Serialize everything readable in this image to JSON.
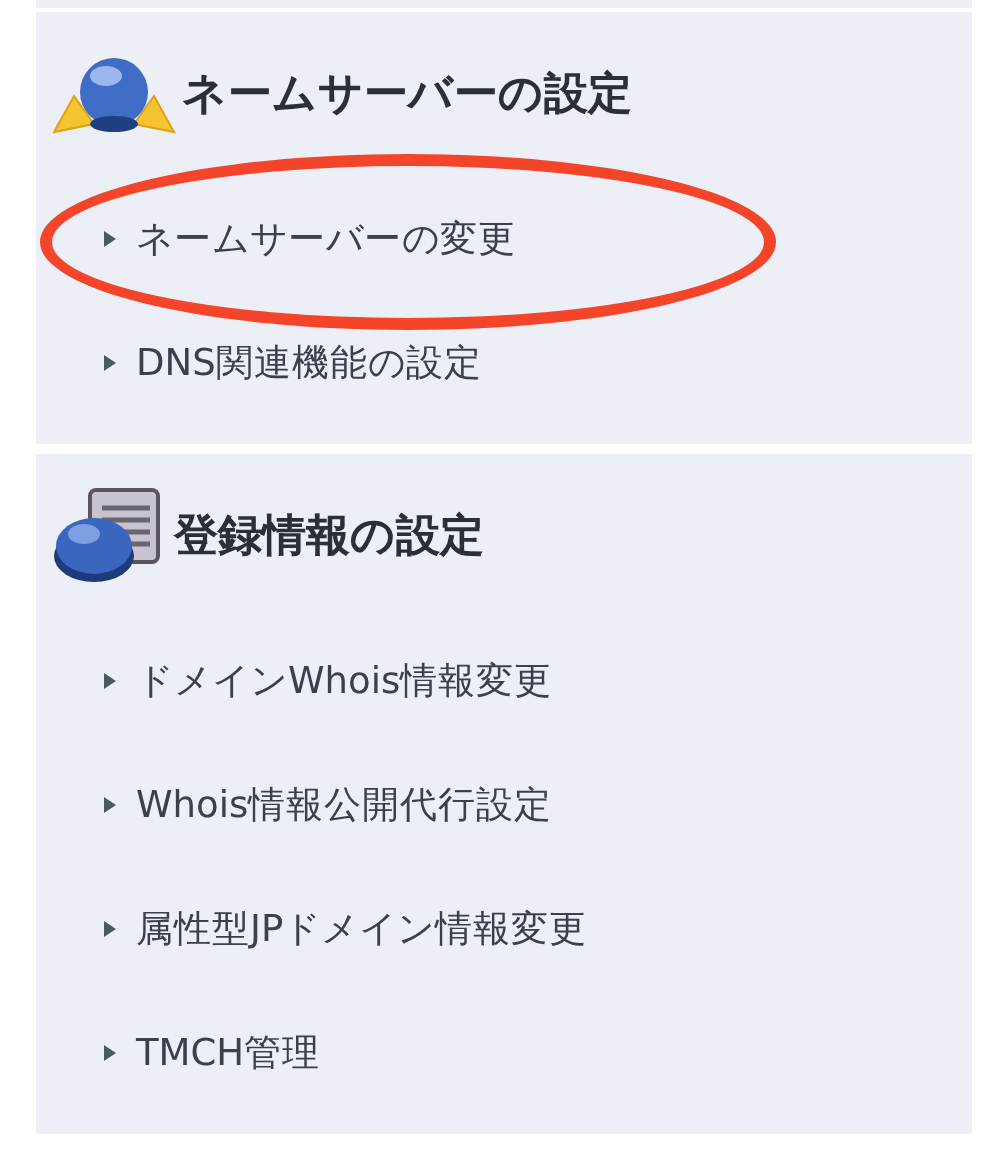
{
  "sections": [
    {
      "kind": "globe",
      "title": "ネームサーバーの設定",
      "items": [
        {
          "label": "ネームサーバーの変更",
          "circled": true
        },
        {
          "label": "DNS関連機能の設定",
          "circled": false
        }
      ]
    },
    {
      "kind": "document",
      "title": "登録情報の設定",
      "items": [
        {
          "label": "ドメインWhois情報変更",
          "circled": false
        },
        {
          "label": "Whois情報公開代行設定",
          "circled": false
        },
        {
          "label": "属性型JPドメイン情報変更",
          "circled": false
        },
        {
          "label": "TMCH管理",
          "circled": false
        }
      ]
    }
  ]
}
